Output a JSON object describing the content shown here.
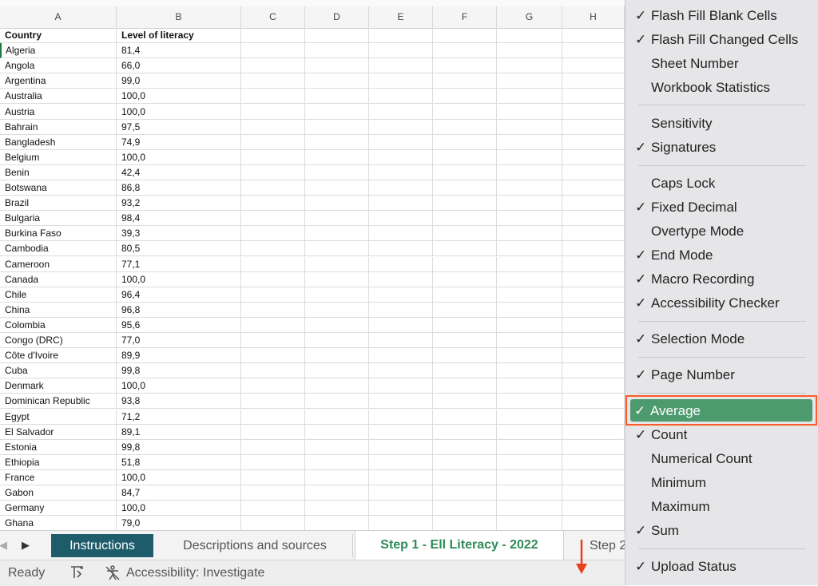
{
  "columns": [
    "A",
    "B",
    "C",
    "D",
    "E",
    "F",
    "G",
    "H"
  ],
  "table": {
    "headers": [
      "Country",
      "Level of literacy"
    ],
    "rows": [
      [
        "Algeria",
        "81,4"
      ],
      [
        "Angola",
        "66,0"
      ],
      [
        "Argentina",
        "99,0"
      ],
      [
        "Australia",
        "100,0"
      ],
      [
        "Austria",
        "100,0"
      ],
      [
        "Bahrain",
        "97,5"
      ],
      [
        "Bangladesh",
        "74,9"
      ],
      [
        "Belgium",
        "100,0"
      ],
      [
        "Benin",
        "42,4"
      ],
      [
        "Botswana",
        "86,8"
      ],
      [
        "Brazil",
        "93,2"
      ],
      [
        "Bulgaria",
        "98,4"
      ],
      [
        "Burkina Faso",
        "39,3"
      ],
      [
        "Cambodia",
        "80,5"
      ],
      [
        "Cameroon",
        "77,1"
      ],
      [
        "Canada",
        "100,0"
      ],
      [
        "Chile",
        "96,4"
      ],
      [
        "China",
        "96,8"
      ],
      [
        "Colombia",
        "95,6"
      ],
      [
        "Congo (DRC)",
        "77,0"
      ],
      [
        "Côte d'Ivoire",
        "89,9"
      ],
      [
        "Cuba",
        "99,8"
      ],
      [
        "Denmark",
        "100,0"
      ],
      [
        "Dominican Republic",
        "93,8"
      ],
      [
        "Egypt",
        "71,2"
      ],
      [
        "El Salvador",
        "89,1"
      ],
      [
        "Estonia",
        "99,8"
      ],
      [
        "Ethiopia",
        "51,8"
      ],
      [
        "France",
        "100,0"
      ],
      [
        "Gabon",
        "84,7"
      ],
      [
        "Germany",
        "100,0"
      ],
      [
        "Ghana",
        "79,0"
      ]
    ]
  },
  "tabs": {
    "prev_icon": "◀",
    "next_icon": "▶",
    "instructions": "Instructions",
    "descriptions": "Descriptions and sources",
    "step1": "Step 1 - Ell Literacy - 2022",
    "step2": "Step 2"
  },
  "status": {
    "ready": "Ready",
    "accessibility": "Accessibility: Investigate"
  },
  "menu": [
    {
      "label": "Flash Fill Blank Cells",
      "checked": true
    },
    {
      "label": "Flash Fill Changed Cells",
      "checked": true
    },
    {
      "label": "Sheet Number",
      "checked": false
    },
    {
      "label": "Workbook Statistics",
      "checked": false
    },
    {
      "sep": true
    },
    {
      "label": "Sensitivity",
      "checked": false
    },
    {
      "label": "Signatures",
      "checked": true
    },
    {
      "sep": true
    },
    {
      "label": "Caps Lock",
      "checked": false
    },
    {
      "label": "Fixed Decimal",
      "checked": true
    },
    {
      "label": "Overtype Mode",
      "checked": false
    },
    {
      "label": "End Mode",
      "checked": true
    },
    {
      "label": "Macro Recording",
      "checked": true
    },
    {
      "label": "Accessibility Checker",
      "checked": true
    },
    {
      "sep": true
    },
    {
      "label": "Selection Mode",
      "checked": true
    },
    {
      "sep": true
    },
    {
      "label": "Page Number",
      "checked": true
    },
    {
      "sep": true
    },
    {
      "label": "Average",
      "checked": true,
      "active": true
    },
    {
      "label": "Count",
      "checked": true
    },
    {
      "label": "Numerical Count",
      "checked": false
    },
    {
      "label": "Minimum",
      "checked": false
    },
    {
      "label": "Maximum",
      "checked": false
    },
    {
      "label": "Sum",
      "checked": true
    },
    {
      "sep": true
    },
    {
      "label": "Upload Status",
      "checked": true
    }
  ],
  "check_glyph": "✓",
  "colors": {
    "accent": "#4c9a6e",
    "highlight_border": "#ff5a2a",
    "active_tab": "#2e8b57",
    "instructions_tab": "#1e5c6c",
    "arrow": "#e8401c"
  }
}
